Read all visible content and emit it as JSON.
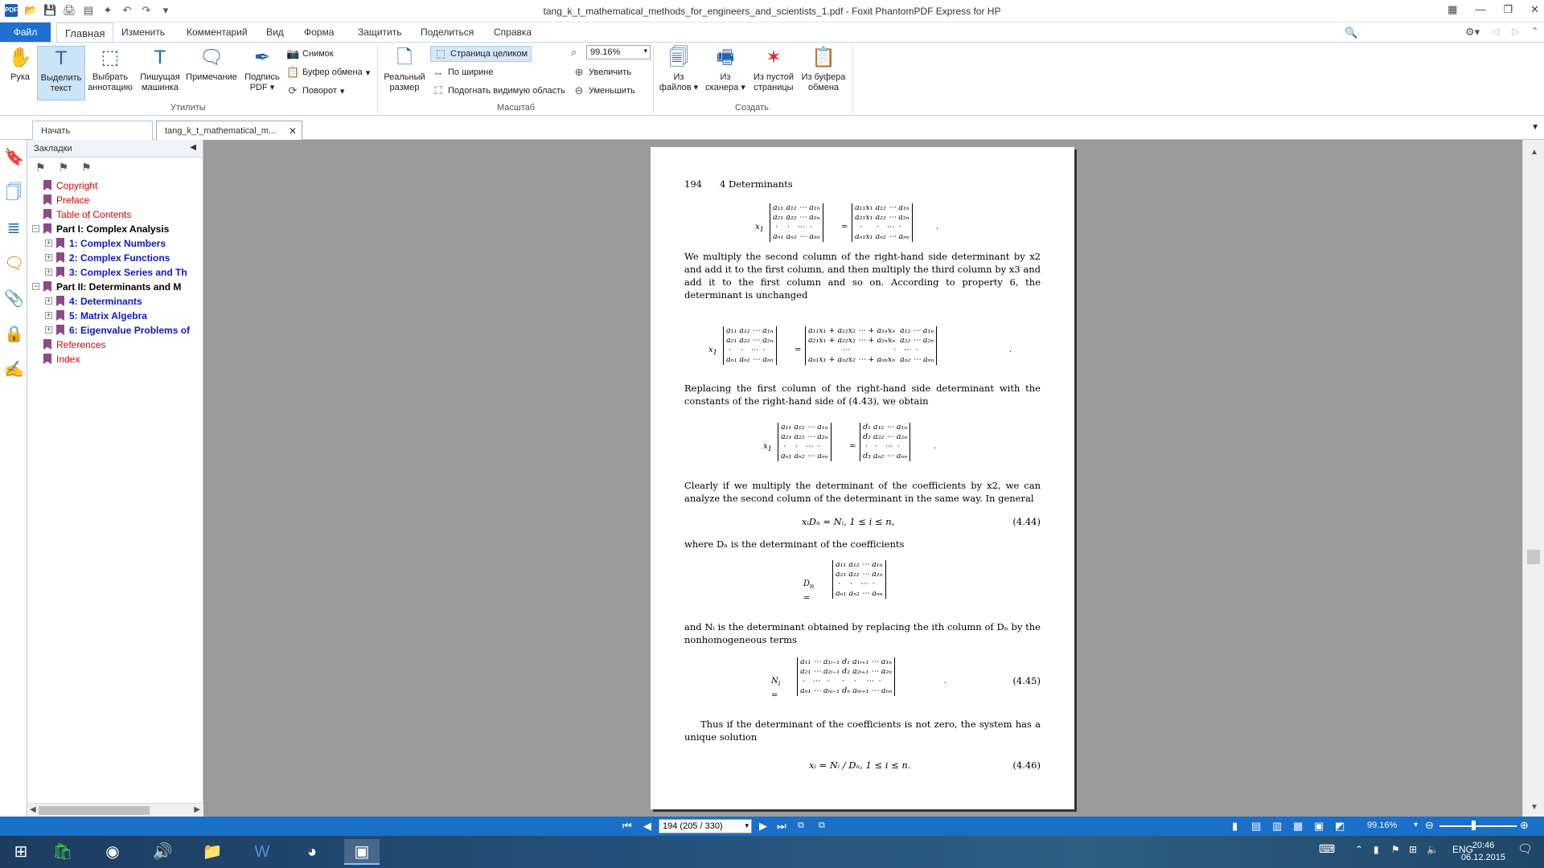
{
  "window": {
    "title": "tang_k_t_mathematical_methods_for_engineers_and_scientists_1.pdf - Foxit PhantomPDF Express for HP",
    "app_icon": "PDF"
  },
  "menu": {
    "file": "Файл",
    "home": "Главная",
    "edit": "Изменить",
    "comment": "Комментарий",
    "view": "Вид",
    "form": "Форма",
    "protect": "Защитить",
    "share": "Поделиться",
    "help": "Справка",
    "search_placeholder": "Поиск"
  },
  "ribbon": {
    "hand": "Рука",
    "select_text": [
      "Выделить",
      "текст"
    ],
    "select_annot": [
      "Выбрать",
      "аннотацию"
    ],
    "typewriter": [
      "Пишущая",
      "машинка"
    ],
    "note": "Примечание",
    "sign": [
      "Подпись",
      "PDF"
    ],
    "snapshot": "Снимок",
    "clipboard": "Буфер обмена",
    "rotate": "Поворот",
    "group_utils": "Утилиты",
    "actual_size": [
      "Реальный",
      "размер"
    ],
    "fit_page": "Страница целиком",
    "fit_width": "По ширине",
    "fit_visible": "Подогнать видимую область",
    "zoom_value": "99.16%",
    "zoom_in": "Увеличить",
    "zoom_out": "Уменьшить",
    "group_zoom": "Масштаб",
    "from_files": [
      "Из",
      "файлов"
    ],
    "from_scanner": [
      "Из",
      "сканера"
    ],
    "from_blank": [
      "Из пустой",
      "страницы"
    ],
    "from_clipboard": [
      "Из буфера",
      "обмена"
    ],
    "group_create": "Создать"
  },
  "tabs": {
    "start": "Начать",
    "doc": "tang_k_t_mathematical_m..."
  },
  "bookmarks": {
    "header": "Закладки",
    "items": [
      {
        "label": "Copyright",
        "style": "red",
        "level": 0
      },
      {
        "label": "Preface",
        "style": "red",
        "level": 0
      },
      {
        "label": "Table of Contents",
        "style": "red",
        "level": 0
      },
      {
        "label": "Part I: Complex Analysis",
        "style": "blk",
        "level": 0,
        "expander": "−"
      },
      {
        "label": "1: Complex Numbers",
        "style": "blu",
        "level": 1,
        "expander": "+"
      },
      {
        "label": "2: Complex Functions",
        "style": "blu",
        "level": 1,
        "expander": "+"
      },
      {
        "label": "3:  Complex Series and Th",
        "style": "blu",
        "level": 1,
        "expander": "+"
      },
      {
        "label": "Part II: Determinants and M",
        "style": "blk",
        "level": 0,
        "expander": "−"
      },
      {
        "label": "4: Determinants",
        "style": "blu",
        "level": 1,
        "expander": "+"
      },
      {
        "label": "5: Matrix Algebra",
        "style": "blu",
        "level": 1,
        "expander": "+"
      },
      {
        "label": "6: Eigenvalue Problems of",
        "style": "blu",
        "level": 1,
        "expander": "+"
      },
      {
        "label": "References",
        "style": "red",
        "level": 0
      },
      {
        "label": "Index",
        "style": "red",
        "level": 0
      }
    ]
  },
  "page": {
    "number": "194",
    "chapter": "4 Determinants",
    "para1": "We multiply the second column of the right-hand side determinant by x2 and add it to the first column, and then multiply the third column by x3 and add it to the first column and so on. According to property 6, the determinant is unchanged",
    "para2": "Replacing the first column of the right-hand side determinant with the constants of the right-hand side of (4.43), we obtain",
    "para3": "Clearly if we multiply the determinant of the coefficients by x2, we can analyze the second column of the determinant in the same way. In general",
    "eq444": "xᵢDₙ = Nᵢ,      1 ≤ i ≤ n,",
    "eq444_no": "(4.44)",
    "para4": "where Dₙ is the determinant of the coefficients",
    "para5": "and Nᵢ is the determinant obtained by replacing the ith column of Dₙ by the nonhomogeneous terms",
    "eq445_no": "(4.45)",
    "para6": "Thus if the determinant of the coefficients is not zero, the system has a unique solution",
    "eq446": "xᵢ = Nᵢ / Dₙ,     1 ≤ i ≤ n.",
    "eq446_no": "(4.46)"
  },
  "status": {
    "page_box": "194 (205 / 330)",
    "zoom": "99.16%"
  },
  "taskbar": {
    "lang": "ENG",
    "time": "20:46",
    "date": "06.12.2015"
  }
}
